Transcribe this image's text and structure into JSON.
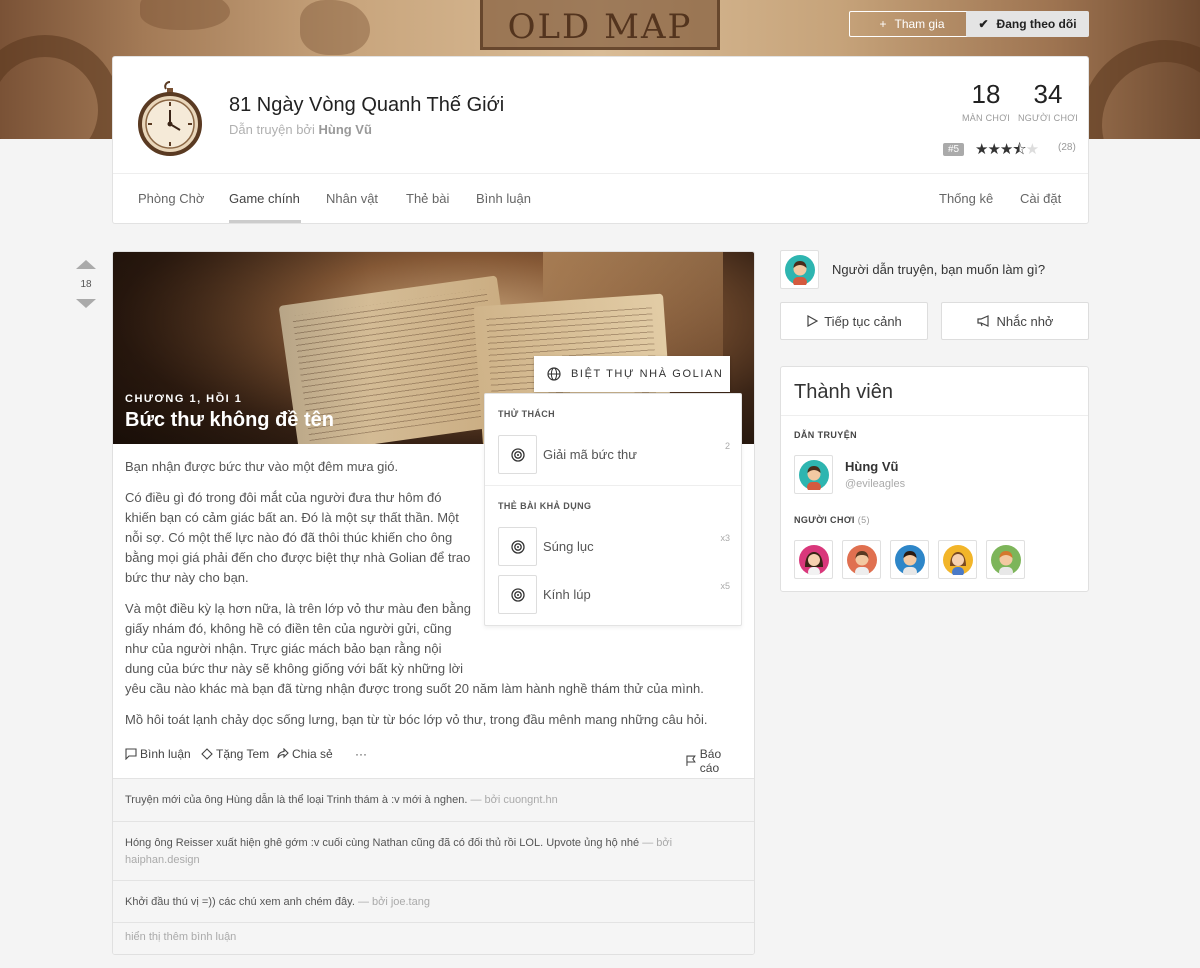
{
  "banner": {
    "title_text": "OLD MAP",
    "join_label": "Tham gia",
    "follow_label": "Đang theo dõi"
  },
  "game": {
    "title": "81 Ngày Vòng Quanh Thế Giới",
    "subtitle_prefix": "Dẫn truyện bởi",
    "narrator": "Hùng Vũ",
    "stats": [
      {
        "value": "18",
        "label": "MÀN CHƠI"
      },
      {
        "value": "34",
        "label": "NGƯỜI CHƠI"
      }
    ],
    "rank": "#5",
    "rating": 3.5,
    "rating_count": "(28)",
    "tabs": [
      "Phòng Chờ",
      "Game chính",
      "Nhân vật",
      "Thẻ bài",
      "Bình luận"
    ],
    "active_tab": "Game chính",
    "right_tabs": [
      "Thống kê",
      "Cài đặt"
    ]
  },
  "post": {
    "votes": "18",
    "chapter": "CHƯƠNG 1, HỒI 1",
    "title": "Bức thư không đề tên",
    "location": "BIỆT THỰ NHÀ GOLIAN",
    "paragraphs": [
      "Bạn nhận được bức thư vào một đêm mưa gió.",
      "Có điều gì đó trong đôi mắt của người đưa thư hôm đó khiến bạn có cảm giác bất an. Đó là một sự thất thần. Một nỗi sợ. Có một thế lực nào đó đã thôi thúc khiến cho ông bằng mọi giá phải đến cho được biệt thự nhà Golian để trao bức thư này cho bạn.",
      "Và một điều kỳ lạ hơn nữa, là trên lớp vỏ thư màu đen bằng giấy nhám đó, không hề có điền tên của người gửi, cũng như của người nhận. Trực giác mách bảo bạn rằng nội dung của bức thư này sẽ không giống với bất kỳ những lời yêu cầu nào khác mà bạn đã từng nhận được trong suốt 20 năm làm hành nghề thám thử của mình.",
      "Mồ hôi toát lạnh chảy dọc sống lưng, bạn từ từ bóc lớp vỏ thư, trong đầu mênh mang những câu hỏi."
    ],
    "challenge_heading": "THỬ THÁCH",
    "challenges": [
      {
        "label": "Giải mã bức thư",
        "count": "2"
      }
    ],
    "cards_heading": "THẺ BÀI KHẢ DỤNG",
    "cards": [
      {
        "label": "Súng lục",
        "count": "x3"
      },
      {
        "label": "Kính lúp",
        "count": "x5"
      }
    ],
    "actions": {
      "comment": "Bình luận",
      "gift": "Tặng Tem",
      "share": "Chia sẻ",
      "more": "···",
      "report": "Báo cáo"
    },
    "comments": [
      {
        "text": "Truyện mới của ông Hùng dẫn là thể loại Trinh thám à :v mới à nghen.",
        "by": "— bởi cuongnt.hn"
      },
      {
        "text": "Hóng ông Reisser xuất hiện ghê gớm :v cuối cùng Nathan cũng đã có đối thủ rồi LOL. Upvote ủng hộ nhé",
        "by": "— bởi",
        "by2": "haiphan.design"
      },
      {
        "text": "Khởi đầu thú vị =)) các chú xem anh chém đây.",
        "by": "— bởi joe.tang"
      }
    ],
    "show_more": "hiển thị thêm bình luận"
  },
  "sidebar": {
    "prompt": "Người dẫn truyện, bạn muốn làm gì?",
    "continue_label": "Tiếp tục cảnh",
    "remind_label": "Nhắc nhở",
    "members_title": "Thành viên",
    "narrator_heading": "DẪN TRUYỆN",
    "narrator_name": "Hùng Vũ",
    "narrator_handle": "@evileagles",
    "players_heading": "NGƯỜI CHƠI",
    "players_count": "(5)"
  },
  "colors": {
    "accent_dark": "#333333",
    "muted": "#999999",
    "avatars": [
      "#d9377b",
      "#e07050",
      "#2e86c8",
      "#f2b529",
      "#7db55a"
    ]
  }
}
